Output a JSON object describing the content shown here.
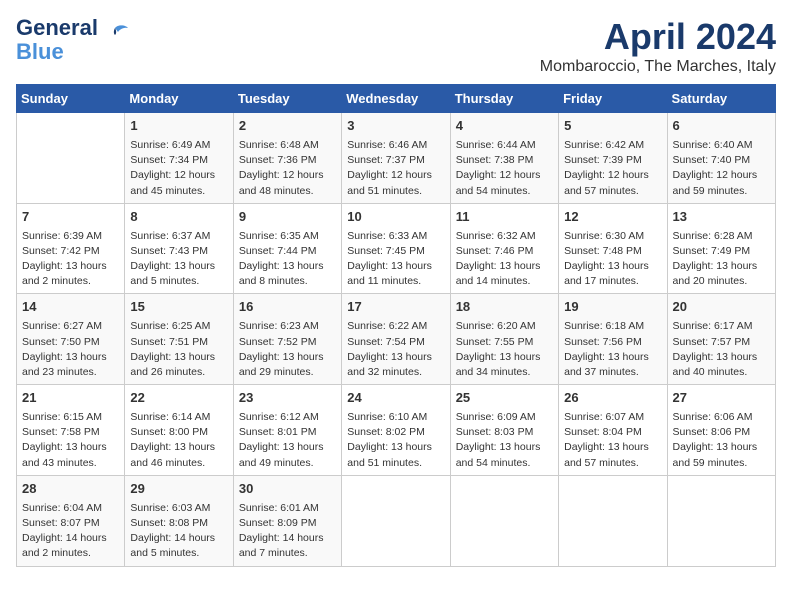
{
  "logo": {
    "line1": "General",
    "line2": "Blue"
  },
  "title": "April 2024",
  "subtitle": "Mombaroccio, The Marches, Italy",
  "days_of_week": [
    "Sunday",
    "Monday",
    "Tuesday",
    "Wednesday",
    "Thursday",
    "Friday",
    "Saturday"
  ],
  "weeks": [
    [
      {
        "day": "",
        "info": ""
      },
      {
        "day": "1",
        "info": "Sunrise: 6:49 AM\nSunset: 7:34 PM\nDaylight: 12 hours\nand 45 minutes."
      },
      {
        "day": "2",
        "info": "Sunrise: 6:48 AM\nSunset: 7:36 PM\nDaylight: 12 hours\nand 48 minutes."
      },
      {
        "day": "3",
        "info": "Sunrise: 6:46 AM\nSunset: 7:37 PM\nDaylight: 12 hours\nand 51 minutes."
      },
      {
        "day": "4",
        "info": "Sunrise: 6:44 AM\nSunset: 7:38 PM\nDaylight: 12 hours\nand 54 minutes."
      },
      {
        "day": "5",
        "info": "Sunrise: 6:42 AM\nSunset: 7:39 PM\nDaylight: 12 hours\nand 57 minutes."
      },
      {
        "day": "6",
        "info": "Sunrise: 6:40 AM\nSunset: 7:40 PM\nDaylight: 12 hours\nand 59 minutes."
      }
    ],
    [
      {
        "day": "7",
        "info": "Sunrise: 6:39 AM\nSunset: 7:42 PM\nDaylight: 13 hours\nand 2 minutes."
      },
      {
        "day": "8",
        "info": "Sunrise: 6:37 AM\nSunset: 7:43 PM\nDaylight: 13 hours\nand 5 minutes."
      },
      {
        "day": "9",
        "info": "Sunrise: 6:35 AM\nSunset: 7:44 PM\nDaylight: 13 hours\nand 8 minutes."
      },
      {
        "day": "10",
        "info": "Sunrise: 6:33 AM\nSunset: 7:45 PM\nDaylight: 13 hours\nand 11 minutes."
      },
      {
        "day": "11",
        "info": "Sunrise: 6:32 AM\nSunset: 7:46 PM\nDaylight: 13 hours\nand 14 minutes."
      },
      {
        "day": "12",
        "info": "Sunrise: 6:30 AM\nSunset: 7:48 PM\nDaylight: 13 hours\nand 17 minutes."
      },
      {
        "day": "13",
        "info": "Sunrise: 6:28 AM\nSunset: 7:49 PM\nDaylight: 13 hours\nand 20 minutes."
      }
    ],
    [
      {
        "day": "14",
        "info": "Sunrise: 6:27 AM\nSunset: 7:50 PM\nDaylight: 13 hours\nand 23 minutes."
      },
      {
        "day": "15",
        "info": "Sunrise: 6:25 AM\nSunset: 7:51 PM\nDaylight: 13 hours\nand 26 minutes."
      },
      {
        "day": "16",
        "info": "Sunrise: 6:23 AM\nSunset: 7:52 PM\nDaylight: 13 hours\nand 29 minutes."
      },
      {
        "day": "17",
        "info": "Sunrise: 6:22 AM\nSunset: 7:54 PM\nDaylight: 13 hours\nand 32 minutes."
      },
      {
        "day": "18",
        "info": "Sunrise: 6:20 AM\nSunset: 7:55 PM\nDaylight: 13 hours\nand 34 minutes."
      },
      {
        "day": "19",
        "info": "Sunrise: 6:18 AM\nSunset: 7:56 PM\nDaylight: 13 hours\nand 37 minutes."
      },
      {
        "day": "20",
        "info": "Sunrise: 6:17 AM\nSunset: 7:57 PM\nDaylight: 13 hours\nand 40 minutes."
      }
    ],
    [
      {
        "day": "21",
        "info": "Sunrise: 6:15 AM\nSunset: 7:58 PM\nDaylight: 13 hours\nand 43 minutes."
      },
      {
        "day": "22",
        "info": "Sunrise: 6:14 AM\nSunset: 8:00 PM\nDaylight: 13 hours\nand 46 minutes."
      },
      {
        "day": "23",
        "info": "Sunrise: 6:12 AM\nSunset: 8:01 PM\nDaylight: 13 hours\nand 49 minutes."
      },
      {
        "day": "24",
        "info": "Sunrise: 6:10 AM\nSunset: 8:02 PM\nDaylight: 13 hours\nand 51 minutes."
      },
      {
        "day": "25",
        "info": "Sunrise: 6:09 AM\nSunset: 8:03 PM\nDaylight: 13 hours\nand 54 minutes."
      },
      {
        "day": "26",
        "info": "Sunrise: 6:07 AM\nSunset: 8:04 PM\nDaylight: 13 hours\nand 57 minutes."
      },
      {
        "day": "27",
        "info": "Sunrise: 6:06 AM\nSunset: 8:06 PM\nDaylight: 13 hours\nand 59 minutes."
      }
    ],
    [
      {
        "day": "28",
        "info": "Sunrise: 6:04 AM\nSunset: 8:07 PM\nDaylight: 14 hours\nand 2 minutes."
      },
      {
        "day": "29",
        "info": "Sunrise: 6:03 AM\nSunset: 8:08 PM\nDaylight: 14 hours\nand 5 minutes."
      },
      {
        "day": "30",
        "info": "Sunrise: 6:01 AM\nSunset: 8:09 PM\nDaylight: 14 hours\nand 7 minutes."
      },
      {
        "day": "",
        "info": ""
      },
      {
        "day": "",
        "info": ""
      },
      {
        "day": "",
        "info": ""
      },
      {
        "day": "",
        "info": ""
      }
    ]
  ]
}
